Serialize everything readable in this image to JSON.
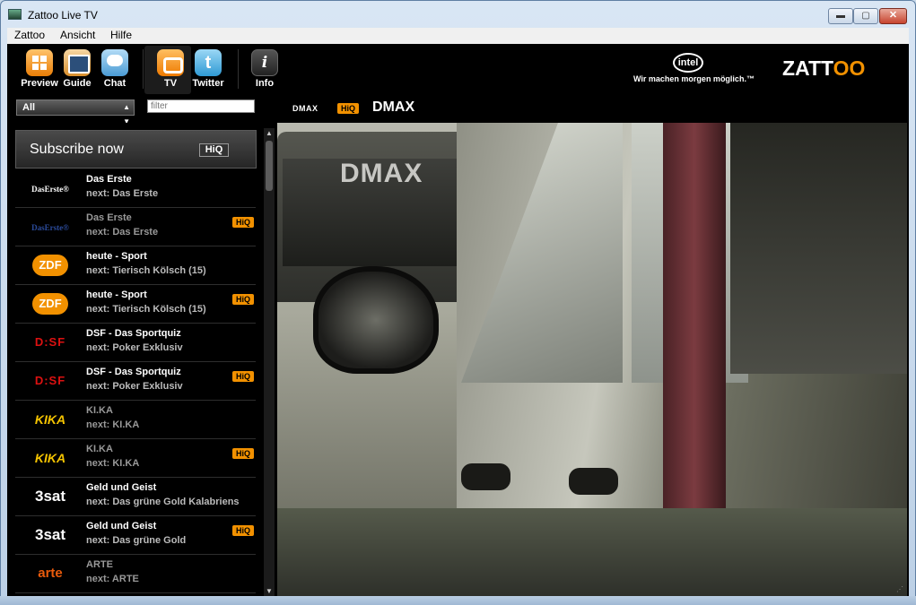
{
  "window": {
    "title": "Zattoo Live TV",
    "min": "▬",
    "max": "▢",
    "close": "✕"
  },
  "menu": [
    "Zattoo",
    "Ansicht",
    "Hilfe"
  ],
  "toolbar": {
    "preview": "Preview",
    "guide": "Guide",
    "chat": "Chat",
    "tv": "TV",
    "twitter": "Twitter",
    "info": "Info",
    "twitter_glyph": "t",
    "info_glyph": "i"
  },
  "branding": {
    "intel": "intel",
    "slogan": "Wir machen morgen möglich.™",
    "zattoo_a": "ZATT",
    "zattoo_b": "OO"
  },
  "filter": {
    "category": "All",
    "placeholder": "filter"
  },
  "now_playing": {
    "logo": "DMAX",
    "badge": "HiQ",
    "channel": "DMAX"
  },
  "subscribe": {
    "text": "Subscribe now",
    "badge": "HiQ"
  },
  "channels": [
    {
      "logo": "DasErste®",
      "title": "Das Erste",
      "next": "next: Das Erste",
      "hiq": false
    },
    {
      "logo": "DasErste®",
      "title": "Das Erste",
      "next": "next: Das Erste",
      "hiq": true
    },
    {
      "logo": "ZDF",
      "title": "heute - Sport",
      "next": "next: Tierisch Kölsch (15)",
      "hiq": false
    },
    {
      "logo": "ZDF",
      "title": "heute - Sport",
      "next": "next: Tierisch Kölsch (15)",
      "hiq": true
    },
    {
      "logo": "D:SF",
      "title": "DSF - Das Sportquiz",
      "next": "next: Poker Exklusiv",
      "hiq": false
    },
    {
      "logo": "D:SF",
      "title": "DSF - Das Sportquiz",
      "next": "next: Poker Exklusiv",
      "hiq": true
    },
    {
      "logo": "KIKA",
      "title": "KI.KA",
      "next": "next: KI.KA",
      "hiq": false
    },
    {
      "logo": "KIKA",
      "title": "KI.KA",
      "next": "next: KI.KA",
      "hiq": true
    },
    {
      "logo": "3sat",
      "title": "Geld und Geist",
      "next": "next: Das grüne Gold Kalabriens",
      "hiq": false
    },
    {
      "logo": "3sat",
      "title": "Geld und Geist",
      "next": "next: Das grüne Gold",
      "hiq": true
    },
    {
      "logo": "arte",
      "title": "ARTE",
      "next": "next: ARTE",
      "hiq": false
    }
  ],
  "hiq_label": "HiQ",
  "video": {
    "overlay_text": "DMAX"
  },
  "colors": {
    "accent": "#f29100",
    "background": "#000000"
  }
}
